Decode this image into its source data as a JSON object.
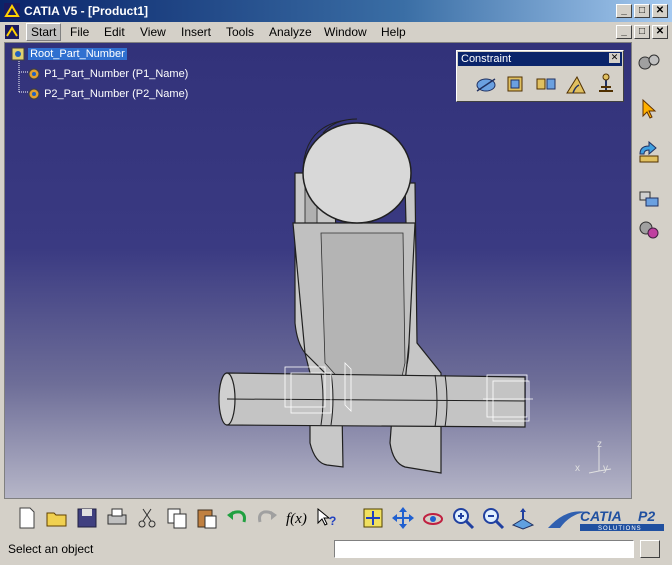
{
  "window": {
    "title": "CATIA V5 - [Product1]",
    "minimize_label": "_",
    "restore_label": "□",
    "close_label": "✕"
  },
  "menu": {
    "items": [
      "Start",
      "File",
      "Edit",
      "View",
      "Insert",
      "Tools",
      "Analyze",
      "Window",
      "Help"
    ]
  },
  "tree": {
    "root": "Root_Part_Number",
    "children": [
      "P1_Part_Number (P1_Name)",
      "P2_Part_Number (P2_Name)"
    ]
  },
  "constraint_toolbar": {
    "title": "Constraint",
    "close_label": "✕",
    "buttons": [
      "coincidence-constraint-icon",
      "contact-constraint-icon",
      "offset-constraint-icon",
      "angle-constraint-icon",
      "fix-component-icon"
    ]
  },
  "compass": {
    "z_label": "z",
    "x_label": "x",
    "y_label": "y"
  },
  "brand": {
    "name": "CATIA",
    "version": "P2",
    "tagline": "SOLUTIONS"
  },
  "status": {
    "message": "Select an object",
    "command_value": ""
  },
  "colors": {
    "title_start": "#0a246a",
    "title_end": "#a6caf0",
    "viewport_top": "#32327a",
    "viewport_bottom": "#b6b6c8",
    "selection": "#3070d0"
  }
}
